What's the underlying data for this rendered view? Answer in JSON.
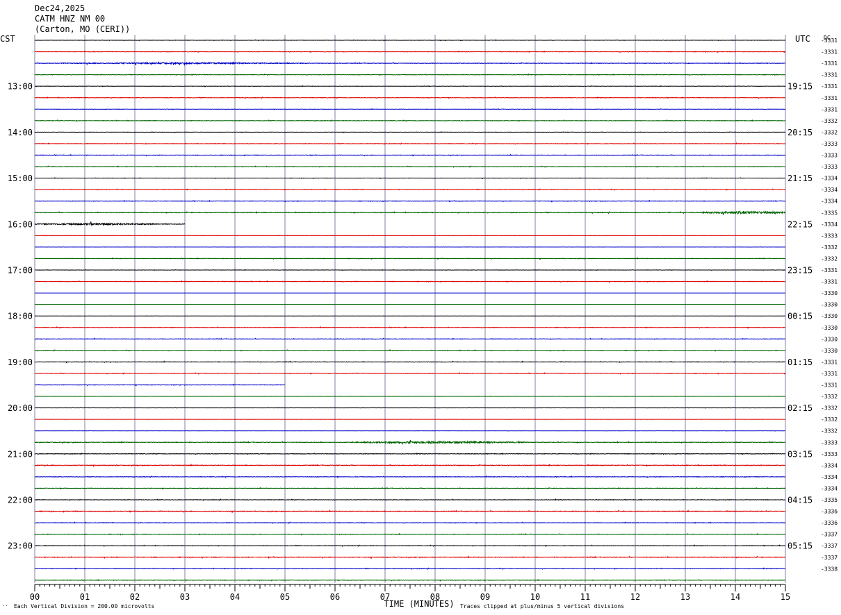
{
  "header": {
    "date": "Dec24,2025",
    "station": "CATM HNZ NM 00",
    "location": "(Carton, MO (CERI))"
  },
  "left_tz": "CST",
  "right_tz": "UTC",
  "dc_label": "DC",
  "footer": {
    "xlabel": "TIME (MINUTES)",
    "scale_note": "Each Vertical Division =  200.00 microvolts",
    "clip_note": "Traces clipped at plus/minus 5 vertical divisions",
    "mark": "´´"
  },
  "colors": {
    "cycle": [
      "#000000",
      "#e00000",
      "#0000c8",
      "#006400"
    ],
    "grid_vertical": "#8080a0",
    "text": "#000000"
  },
  "chart_data": {
    "type": "line",
    "subtype": "helicorder",
    "minutes_per_line": 15,
    "x_ticks": [
      "00",
      "01",
      "02",
      "03",
      "04",
      "05",
      "06",
      "07",
      "08",
      "09",
      "10",
      "11",
      "12",
      "13",
      "14",
      "15"
    ],
    "x_range": [
      0,
      15
    ],
    "left_hour_labels": [
      "13:00",
      "14:00",
      "15:00",
      "16:00",
      "17:00",
      "18:00",
      "19:00",
      "20:00",
      "21:00",
      "22:00",
      "23:00"
    ],
    "right_hour_labels": [
      "19:15",
      "20:15",
      "21:15",
      "22:15",
      "23:15",
      "00:15",
      "01:15",
      "02:15",
      "03:15",
      "04:15",
      "05:15"
    ],
    "dc_offsets": [
      "-3331",
      "-3331",
      "-3331",
      "-3331",
      "-3331",
      "-3331",
      "-3331",
      "-3332",
      "-3332",
      "-3333",
      "-3333",
      "-3333",
      "-3334",
      "-3334",
      "-3334",
      "-3335",
      "-3334",
      "-3333",
      "-3332",
      "-3332",
      "-3331",
      "-3331",
      "-3330",
      "-3330",
      "-3330",
      "-3330",
      "-3330",
      "-3330",
      "-3331",
      "-3331",
      "-3331",
      "-3332",
      "-3332",
      "-3332",
      "-3332",
      "-3333",
      "-3333",
      "-3334",
      "-3334",
      "-3334",
      "-3335",
      "-3336",
      "-3336",
      "-3337",
      "-3337",
      "-3337",
      "-3338"
    ],
    "traces": [
      {
        "amp": 0.2,
        "active": [
          0,
          15
        ]
      },
      {
        "amp": 0.3,
        "active": [
          0,
          15
        ]
      },
      {
        "amp": 0.3,
        "active": [
          0,
          15
        ]
      },
      {
        "amp": 0.3,
        "active": [
          0,
          15
        ]
      },
      {
        "amp": 0.2,
        "active": [
          0,
          15
        ]
      },
      {
        "amp": 0.3,
        "active": [
          0,
          15
        ]
      },
      {
        "amp": 0.2,
        "active": [
          0,
          15
        ]
      },
      {
        "amp": 0.3,
        "active": [
          0,
          15
        ]
      },
      {
        "amp": 0.2,
        "active": [
          0,
          15
        ]
      },
      {
        "amp": 0.3,
        "active": [
          0,
          15
        ]
      },
      {
        "amp": 0.3,
        "active": [
          0,
          15
        ]
      },
      {
        "amp": 0.3,
        "active": [
          0,
          15
        ]
      },
      {
        "amp": 0.2,
        "active": [
          0,
          15
        ]
      },
      {
        "amp": 0.3,
        "active": [
          0,
          15
        ]
      },
      {
        "amp": 0.3,
        "active": [
          0,
          15
        ]
      },
      {
        "amp": 0.4,
        "active": [
          0,
          15
        ]
      },
      {
        "amp": 0.5,
        "active": [
          0,
          3
        ]
      },
      {
        "amp": 0.1,
        "active": [
          0,
          15
        ]
      },
      {
        "amp": 0.1,
        "active": [
          0,
          15
        ]
      },
      {
        "amp": 0.3,
        "active": [
          0,
          15
        ]
      },
      {
        "amp": 0.2,
        "active": [
          0,
          15
        ]
      },
      {
        "amp": 0.3,
        "active": [
          0,
          15
        ]
      },
      {
        "amp": 0.0,
        "active": [
          0,
          15
        ]
      },
      {
        "amp": 0.0,
        "active": [
          0,
          15
        ]
      },
      {
        "amp": 0.1,
        "active": [
          0,
          15
        ]
      },
      {
        "amp": 0.3,
        "active": [
          0,
          15
        ]
      },
      {
        "amp": 0.3,
        "active": [
          0,
          15
        ]
      },
      {
        "amp": 0.3,
        "active": [
          0,
          15
        ]
      },
      {
        "amp": 0.3,
        "active": [
          0,
          15
        ]
      },
      {
        "amp": 0.3,
        "active": [
          0,
          15
        ]
      },
      {
        "amp": 0.3,
        "active": [
          0,
          5
        ]
      },
      {
        "amp": 0.1,
        "active": [
          0,
          15
        ]
      },
      {
        "amp": 0.1,
        "active": [
          0,
          15
        ]
      },
      {
        "amp": 0.1,
        "active": [
          0,
          15
        ]
      },
      {
        "amp": 0.1,
        "active": [
          0,
          15
        ]
      },
      {
        "amp": 0.4,
        "active": [
          0,
          15
        ]
      },
      {
        "amp": 0.3,
        "active": [
          0,
          15
        ]
      },
      {
        "amp": 0.4,
        "active": [
          0,
          15
        ]
      },
      {
        "amp": 0.3,
        "active": [
          0,
          15
        ]
      },
      {
        "amp": 0.3,
        "active": [
          0,
          15
        ]
      },
      {
        "amp": 0.3,
        "active": [
          0,
          15
        ]
      },
      {
        "amp": 0.4,
        "active": [
          0,
          15
        ]
      },
      {
        "amp": 0.3,
        "active": [
          0,
          15
        ]
      },
      {
        "amp": 0.3,
        "active": [
          0,
          15
        ]
      },
      {
        "amp": 0.3,
        "active": [
          0,
          15
        ]
      },
      {
        "amp": 0.4,
        "active": [
          0,
          15
        ]
      },
      {
        "amp": 0.3,
        "active": [
          0,
          15
        ]
      },
      {
        "amp": 0.3,
        "active": [
          0,
          15
        ]
      }
    ],
    "events": [
      {
        "trace": 2,
        "t0": 0.5,
        "t1": 5.5,
        "amp": 1.0
      },
      {
        "trace": 15,
        "t0": 13.3,
        "t1": 15,
        "amp": 2.0
      },
      {
        "trace": 16,
        "t0": 0,
        "t1": 2.5,
        "amp": 1.3
      },
      {
        "trace": 35,
        "t0": 6.3,
        "t1": 9.8,
        "amp": 1.5
      }
    ]
  }
}
